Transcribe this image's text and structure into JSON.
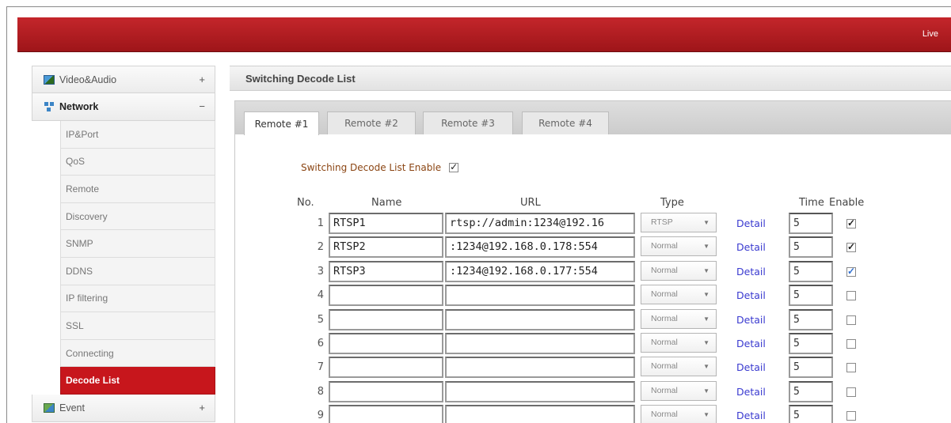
{
  "topbar": {
    "live_label": "Live"
  },
  "sidebar": {
    "video_audio": {
      "label": "Video&Audio",
      "toggle": "+"
    },
    "network": {
      "label": "Network",
      "toggle": "−"
    },
    "network_items": [
      {
        "label": "IP&Port"
      },
      {
        "label": "QoS"
      },
      {
        "label": "Remote"
      },
      {
        "label": "Discovery"
      },
      {
        "label": "SNMP"
      },
      {
        "label": "DDNS"
      },
      {
        "label": "IP filtering"
      },
      {
        "label": "SSL"
      },
      {
        "label": "Connecting"
      },
      {
        "label": "Decode List"
      }
    ],
    "active_item": "Decode List",
    "event": {
      "label": "Event",
      "toggle": "+"
    }
  },
  "main": {
    "section_title": "Switching Decode List",
    "tabs": [
      "Remote #1",
      "Remote #2",
      "Remote #3",
      "Remote #4"
    ],
    "active_tab": "Remote #1",
    "enable_label": "Switching Decode List Enable",
    "enable_checked": true,
    "columns": {
      "no": "No.",
      "name": "Name",
      "url": "URL",
      "type": "Type",
      "time": "Time",
      "enable": "Enable"
    },
    "detail_label": "Detail",
    "rows": [
      {
        "no": "1",
        "name": "RTSP1",
        "url": "rtsp://admin:1234@192.16",
        "type": "RTSP",
        "time": "5",
        "enabled": true
      },
      {
        "no": "2",
        "name": "RTSP2",
        "url": ":1234@192.168.0.178:554",
        "type": "Normal",
        "time": "5",
        "enabled": true
      },
      {
        "no": "3",
        "name": "RTSP3",
        "url": ":1234@192.168.0.177:554",
        "type": "Normal",
        "time": "5",
        "enabled": true
      },
      {
        "no": "4",
        "name": "",
        "url": "",
        "type": "Normal",
        "time": "5",
        "enabled": false
      },
      {
        "no": "5",
        "name": "",
        "url": "",
        "type": "Normal",
        "time": "5",
        "enabled": false
      },
      {
        "no": "6",
        "name": "",
        "url": "",
        "type": "Normal",
        "time": "5",
        "enabled": false
      },
      {
        "no": "7",
        "name": "",
        "url": "",
        "type": "Normal",
        "time": "5",
        "enabled": false
      },
      {
        "no": "8",
        "name": "",
        "url": "",
        "type": "Normal",
        "time": "5",
        "enabled": false
      },
      {
        "no": "9",
        "name": "",
        "url": "",
        "type": "Normal",
        "time": "5",
        "enabled": false
      }
    ]
  },
  "colors": {
    "topbar": "#b51d22",
    "active_menu": "#c7161c",
    "detail_link": "#3a3ad0",
    "enable_label": "#8b4513"
  }
}
